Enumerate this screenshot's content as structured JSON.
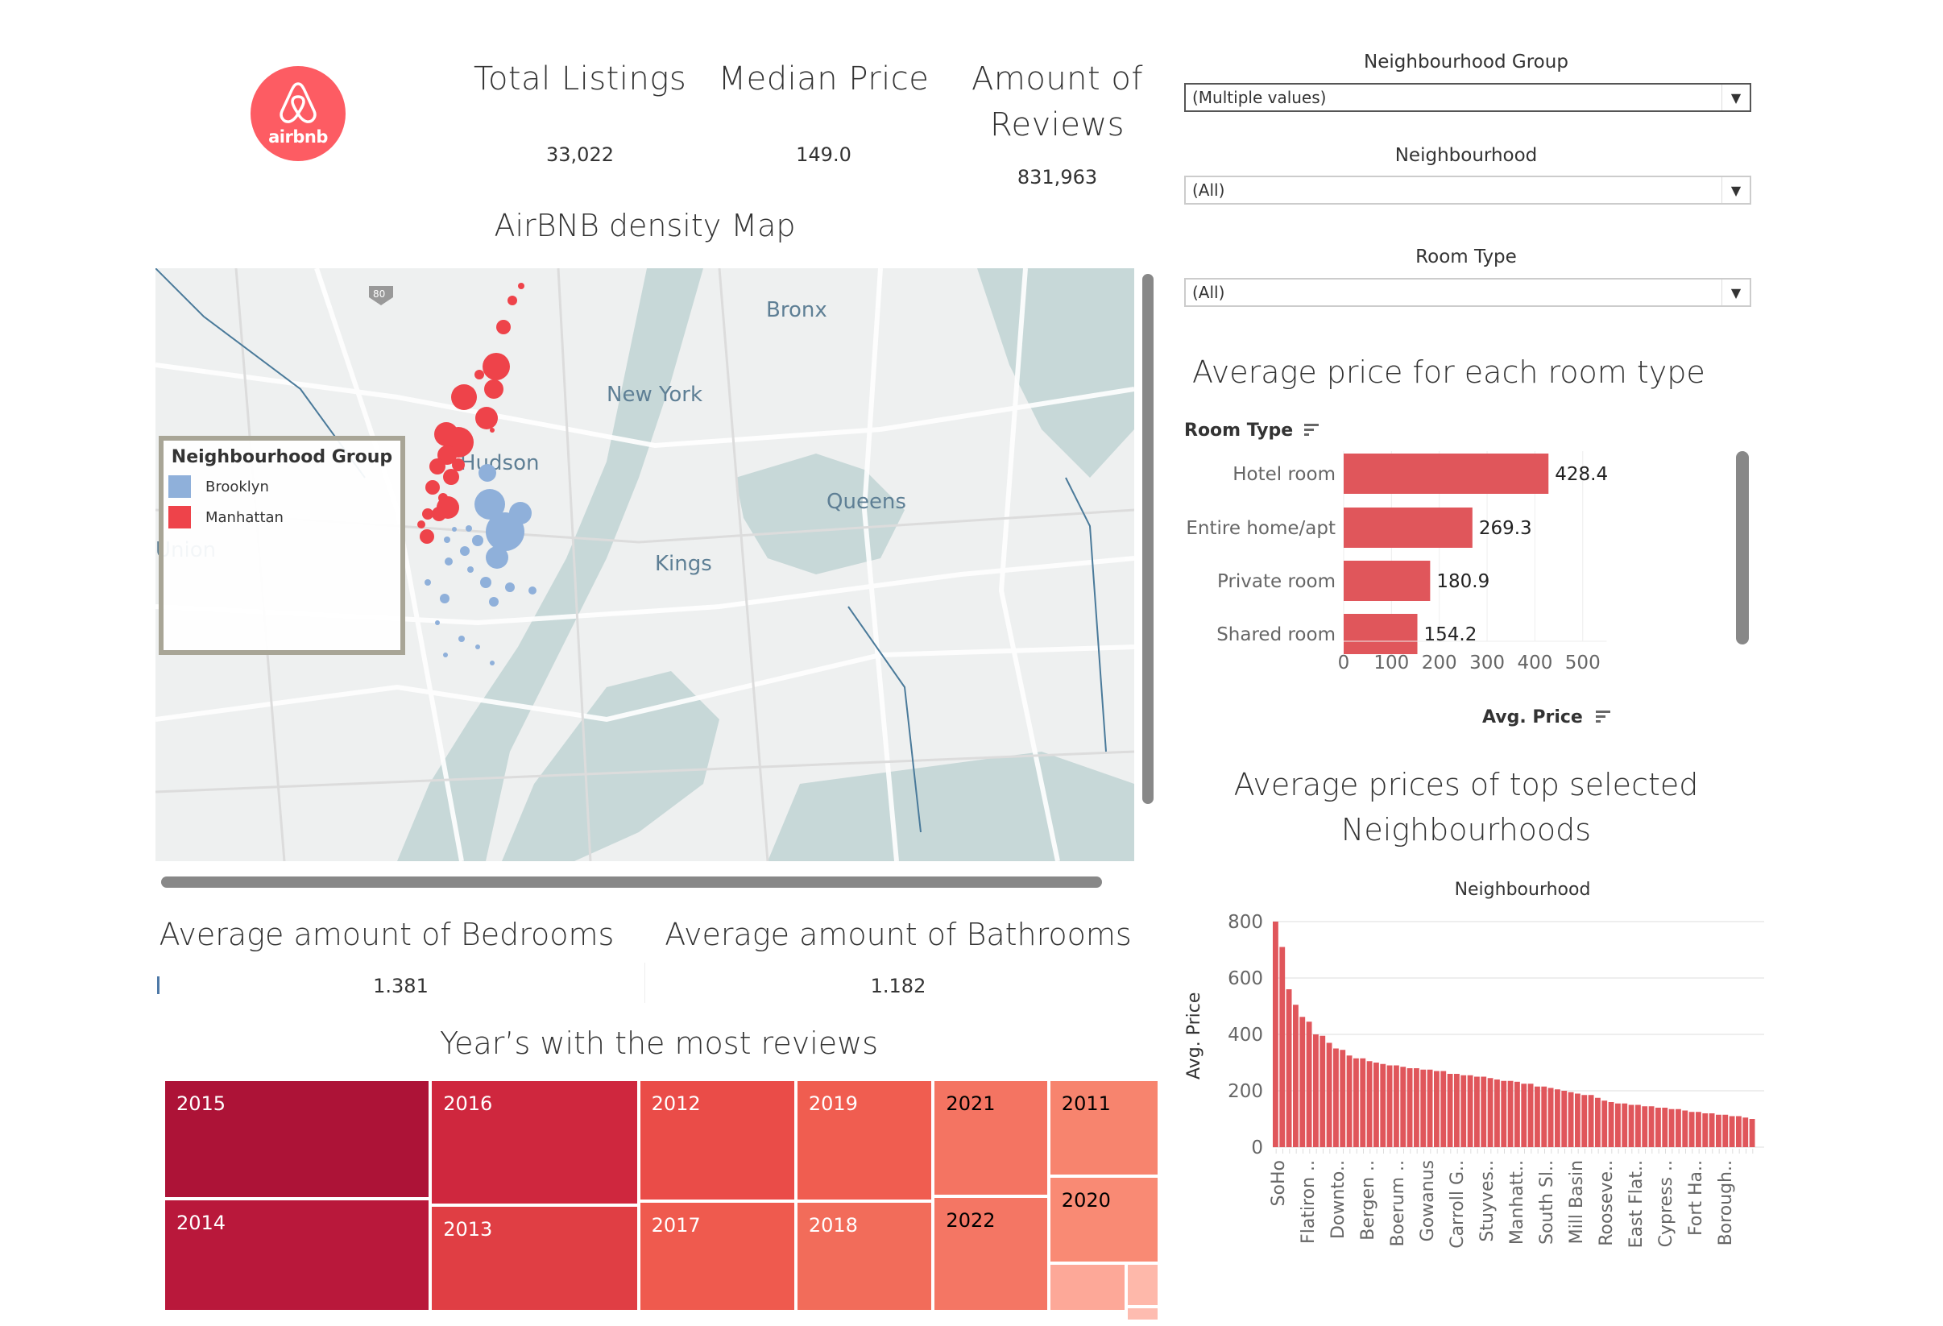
{
  "logo": {
    "text": "airbnb",
    "icon": "airbnb-belo-icon",
    "color": "#fd5c63"
  },
  "kpis": [
    {
      "title": "Total Listings",
      "value": "33,022"
    },
    {
      "title": "Median Price",
      "value": "149.0"
    },
    {
      "title_line1": "Amount of",
      "title_line2": "Reviews",
      "value": "831,963"
    }
  ],
  "filters": {
    "neighbourhood_group": {
      "label": "Neighbourhood Group",
      "value": "(Multiple values)"
    },
    "neighbourhood": {
      "label": "Neighbourhood",
      "value": "(All)"
    },
    "room_type": {
      "label": "Room Type",
      "value": "(All)"
    }
  },
  "map": {
    "title": "AirBNB density Map",
    "place_labels": [
      "Bronx",
      "New York",
      "Hudson",
      "Queens",
      "Union",
      "Kings",
      "80"
    ],
    "legend": {
      "title": "Neighbourhood Group",
      "items": [
        {
          "label": "Brooklyn",
          "color": "#8fb0da"
        },
        {
          "label": "Manhattan",
          "color": "#ee434a"
        }
      ]
    }
  },
  "metrics": {
    "bedrooms": {
      "title": "Average amount of Bedrooms",
      "value": "1.381"
    },
    "bathrooms": {
      "title": "Average amount of Bathrooms",
      "value": "1.182"
    }
  },
  "chart_data": [
    {
      "type": "bar",
      "orientation": "horizontal",
      "title": "Average price for each room type",
      "ylabel": "Room Type",
      "xlabel": "Avg. Price",
      "categories": [
        "Hotel room",
        "Entire home/apt",
        "Private room",
        "Shared room"
      ],
      "values": [
        428.4,
        269.3,
        180.9,
        154.2
      ],
      "value_labels": [
        "428.4",
        "269.3",
        "180.9",
        "154.2"
      ],
      "xlim": [
        0,
        550
      ],
      "xticks": [
        "0",
        "100",
        "200",
        "300",
        "400",
        "500"
      ],
      "color": "#e0565b",
      "grid": true
    },
    {
      "type": "bar",
      "title_line1": "Average prices of top selected",
      "title_line2": "Neighbourhoods",
      "xlabel": "Neighbourhood",
      "ylabel": "Avg. Price",
      "ylim": [
        0,
        800
      ],
      "yticks": [
        "0",
        "200",
        "400",
        "600",
        "800"
      ],
      "visible_category_labels": [
        "SoHo",
        "Flatiron ..",
        "Downto..",
        "Bergen ..",
        "Boerum ..",
        "Gowanus",
        "Carroll G..",
        "Stuyves..",
        "Manhatt..",
        "South Sl..",
        "Mill Basin",
        "Rooseve..",
        "East Flat..",
        "Cypress ..",
        "Fort Ha..",
        "Borough.."
      ],
      "values": [
        800,
        710,
        560,
        505,
        462,
        445,
        400,
        395,
        370,
        350,
        345,
        325,
        315,
        315,
        305,
        300,
        295,
        290,
        290,
        285,
        280,
        280,
        275,
        275,
        270,
        270,
        260,
        260,
        255,
        255,
        250,
        250,
        245,
        240,
        235,
        235,
        232,
        225,
        225,
        215,
        215,
        210,
        205,
        200,
        195,
        190,
        185,
        185,
        175,
        165,
        160,
        155,
        155,
        150,
        150,
        145,
        145,
        140,
        140,
        135,
        135,
        130,
        125,
        125,
        120,
        120,
        115,
        115,
        110,
        110,
        105,
        100
      ],
      "color": "#e0565b",
      "grid": true
    },
    {
      "type": "treemap",
      "title": "Year’s with the most reviews",
      "cells": [
        {
          "label": "2015",
          "color": "#ad1337",
          "text_color": "#ffffff"
        },
        {
          "label": "2014",
          "color": "#b9183b",
          "text_color": "#ffffff"
        },
        {
          "label": "2016",
          "color": "#cf273e",
          "text_color": "#ffffff"
        },
        {
          "label": "2013",
          "color": "#e03e44",
          "text_color": "#ffffff"
        },
        {
          "label": "2012",
          "color": "#ea4c48",
          "text_color": "#ffffff"
        },
        {
          "label": "2017",
          "color": "#ef5a4e",
          "text_color": "#ffffff"
        },
        {
          "label": "2019",
          "color": "#f05d50",
          "text_color": "#ffffff"
        },
        {
          "label": "2018",
          "color": "#f26c5a",
          "text_color": "#ffffff"
        },
        {
          "label": "2021",
          "color": "#f47462",
          "text_color": "#000000"
        },
        {
          "label": "2022",
          "color": "#f47664",
          "text_color": "#000000"
        },
        {
          "label": "2011",
          "color": "#f7846e",
          "text_color": "#000000"
        },
        {
          "label": "2020",
          "color": "#f98a74",
          "text_color": "#000000"
        },
        {
          "label": "",
          "color": "#fda898",
          "text_color": "#000000"
        },
        {
          "label": "",
          "color": "#feb8aa",
          "text_color": "#000000"
        },
        {
          "label": "",
          "color": "#febcb0",
          "text_color": "#000000"
        }
      ]
    }
  ]
}
